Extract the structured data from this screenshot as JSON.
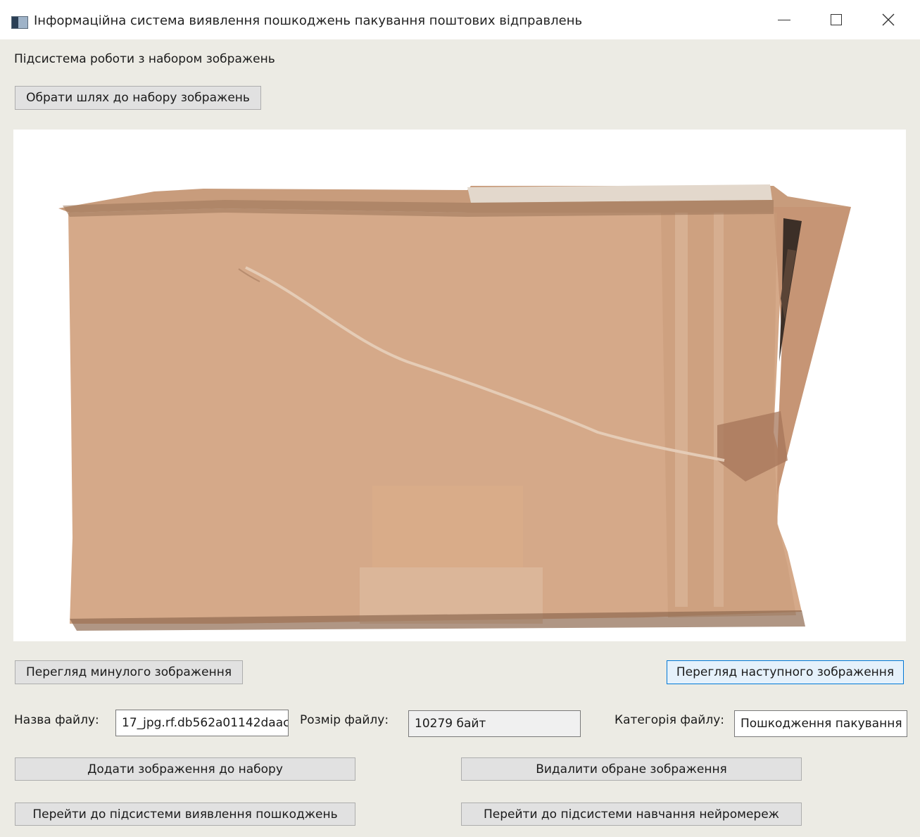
{
  "window": {
    "title": "Інформаційна система виявлення пошкоджень пакування поштових відправлень"
  },
  "subsystem_label": "Підсистема роботи з набором зображень",
  "buttons": {
    "choose_path": "Обрати шлях до набору зображень",
    "prev_image": "Перегляд минулого зображення",
    "next_image": "Перегляд наступного зображення",
    "add_image": "Додати зображення до набору",
    "delete_image": "Видалити обране зображення",
    "goto_detection": "Перейти до підсистеми виявлення пошкоджень",
    "goto_training": "Перейти до підсистеми навчання нейромереж"
  },
  "file_info": {
    "name_label": "Назва файлу:",
    "name_value": "17_jpg.rf.db562a01142daac",
    "size_label": "Розмір файлу:",
    "size_value": "10279 байт",
    "category_label": "Категорія файлу:",
    "category_value": "Пошкодження пакування"
  },
  "colors": {
    "window_bg": "#ecebe4",
    "button_bg": "#e1e1e1",
    "focus_border": "#0078d7",
    "cardboard": "#d5a989"
  },
  "icons": {
    "app": "app-window-icon",
    "minimize": "minimize-icon",
    "maximize": "maximize-icon",
    "close": "close-icon"
  }
}
